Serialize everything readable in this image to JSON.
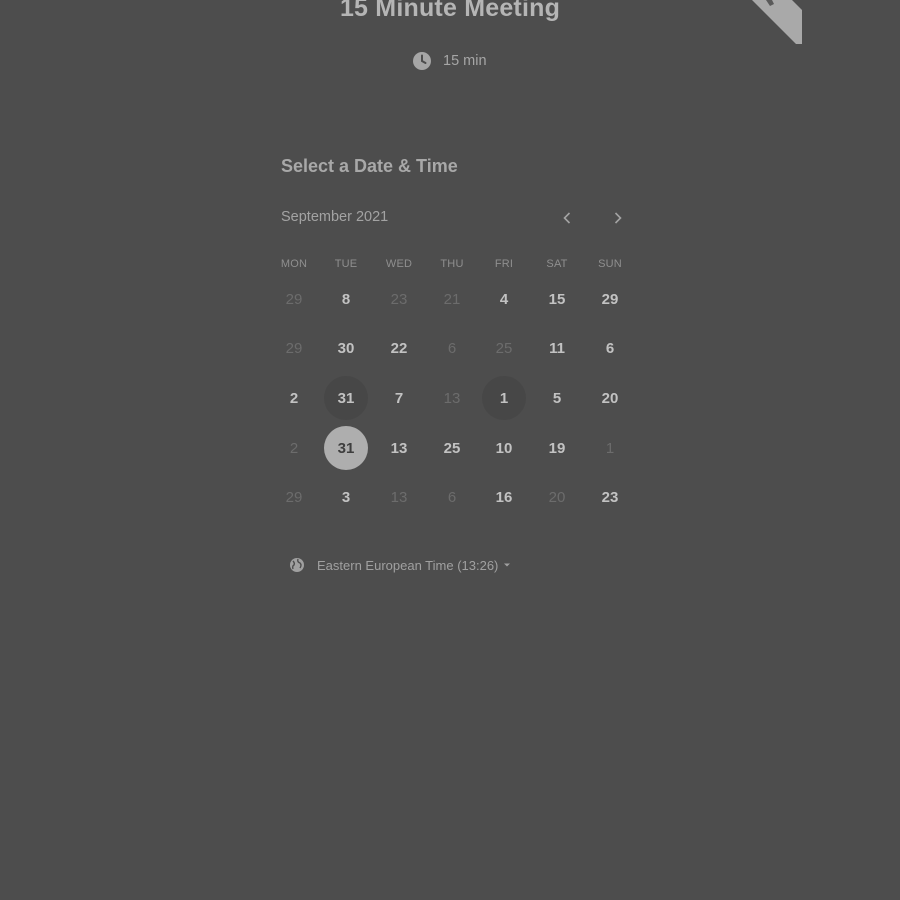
{
  "title": "15 Minute Meeting",
  "duration": {
    "label": "15 min",
    "icon": "clock-icon"
  },
  "heading": "Select a Date & Time",
  "calendar": {
    "month_label": "September 2021",
    "prev_icon": "chevron-left-icon",
    "next_icon": "chevron-right-icon",
    "weekdays": [
      "MON",
      "TUE",
      "WED",
      "THU",
      "FRI",
      "SAT",
      "SUN"
    ],
    "weeks": [
      [
        {
          "d": "29",
          "s": "dim"
        },
        {
          "d": "8",
          "s": "avail"
        },
        {
          "d": "23",
          "s": "dim"
        },
        {
          "d": "21",
          "s": "dim"
        },
        {
          "d": "4",
          "s": "avail"
        },
        {
          "d": "15",
          "s": "avail"
        },
        {
          "d": "29",
          "s": "avail"
        }
      ],
      [
        {
          "d": "29",
          "s": "dim"
        },
        {
          "d": "30",
          "s": "avail"
        },
        {
          "d": "22",
          "s": "avail"
        },
        {
          "d": "6",
          "s": "dim"
        },
        {
          "d": "25",
          "s": "dim"
        },
        {
          "d": "11",
          "s": "avail"
        },
        {
          "d": "6",
          "s": "avail"
        }
      ],
      [
        {
          "d": "2",
          "s": "avail"
        },
        {
          "d": "31",
          "s": "hl"
        },
        {
          "d": "7",
          "s": "avail"
        },
        {
          "d": "13",
          "s": "dim"
        },
        {
          "d": "1",
          "s": "hl"
        },
        {
          "d": "5",
          "s": "avail"
        },
        {
          "d": "20",
          "s": "avail"
        }
      ],
      [
        {
          "d": "2",
          "s": "dim"
        },
        {
          "d": "31",
          "s": "sel"
        },
        {
          "d": "13",
          "s": "avail"
        },
        {
          "d": "25",
          "s": "avail"
        },
        {
          "d": "10",
          "s": "avail"
        },
        {
          "d": "19",
          "s": "avail"
        },
        {
          "d": "1",
          "s": "dim"
        }
      ],
      [
        {
          "d": "29",
          "s": "dim"
        },
        {
          "d": "3",
          "s": "avail"
        },
        {
          "d": "13",
          "s": "dim"
        },
        {
          "d": "6",
          "s": "dim"
        },
        {
          "d": "16",
          "s": "avail"
        },
        {
          "d": "20",
          "s": "dim"
        },
        {
          "d": "23",
          "s": "avail"
        }
      ]
    ]
  },
  "timezone": {
    "label": "Eastern European Time (13:26)",
    "icon": "globe-icon",
    "caret_icon": "caret-down-icon"
  },
  "colors": {
    "background": "#4d4d4d",
    "selected": "#aeaeae",
    "available_text": "#c2c2c2",
    "unavailable_text": "#6c6c6c"
  }
}
